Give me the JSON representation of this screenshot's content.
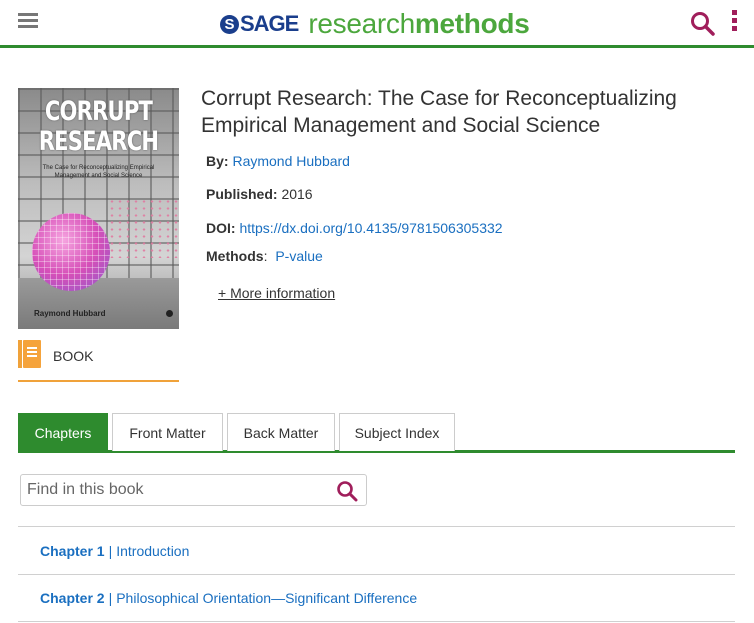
{
  "header": {
    "brand_mark": "S",
    "brand_publisher": "SAGE",
    "brand_product_light": "research",
    "brand_product_bold": "methods",
    "icons": {
      "menu": "hamburger-icon",
      "search": "search-icon",
      "more": "kebab-menu-icon"
    },
    "accent_color": "#2e8b2e",
    "icon_color": "#a01e5b"
  },
  "book": {
    "cover": {
      "title_line1": "CORRUPT",
      "title_line2": "RESEARCH",
      "subtitle": "The Case for Reconceptualizing Empirical Management and Social Science",
      "author": "Raymond Hubbard",
      "publisher_mark": "S"
    },
    "type": {
      "icon": "book-icon",
      "label": "BOOK"
    },
    "title": "Corrupt Research: The Case for Reconceptualizing Empirical Management and Social Science",
    "meta": {
      "by_label": "By:",
      "by_value": "Raymond Hubbard",
      "published_label": "Published:",
      "published_value": "2016",
      "doi_label": "DOI:",
      "doi_value": "https://dx.doi.org/10.4135/9781506305332",
      "methods_label": "Methods",
      "methods_sep": ":",
      "methods_value": "P-value"
    },
    "more_info": "+ More information"
  },
  "tabs": [
    {
      "label": "Chapters",
      "active": true
    },
    {
      "label": "Front Matter",
      "active": false
    },
    {
      "label": "Back Matter",
      "active": false
    },
    {
      "label": "Subject Index",
      "active": false
    }
  ],
  "find": {
    "placeholder": "Find in this book",
    "value": ""
  },
  "chapters": [
    {
      "number": "Chapter 1",
      "separator": "|",
      "title": "Introduction"
    },
    {
      "number": "Chapter 2",
      "separator": "|",
      "title": "Philosophical Orientation—Significant Difference"
    }
  ]
}
